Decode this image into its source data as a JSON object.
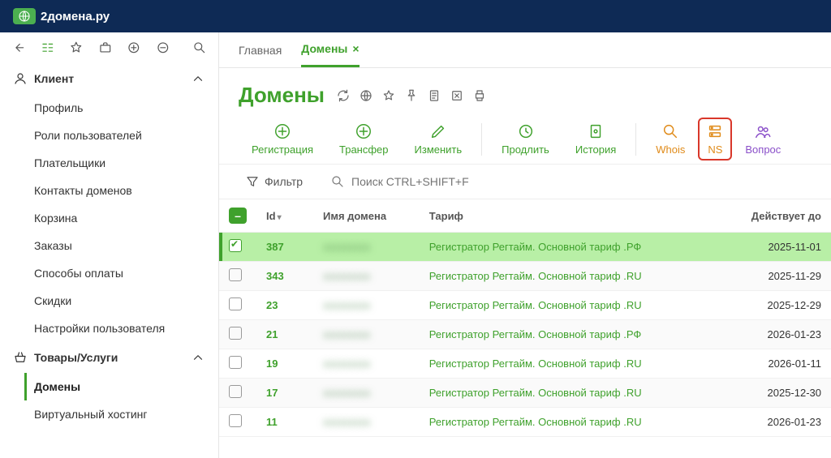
{
  "brand": "2домена.ру",
  "sidebar": {
    "section1": {
      "title": "Клиент",
      "items": [
        "Профиль",
        "Роли пользователей",
        "Плательщики",
        "Контакты доменов",
        "Корзина",
        "Заказы",
        "Способы оплаты",
        "Скидки",
        "Настройки пользователя"
      ]
    },
    "section2": {
      "title": "Товары/Услуги",
      "items": [
        "Домены",
        "Виртуальный хостинг"
      ],
      "active_index": 0
    }
  },
  "tabs": [
    {
      "label": "Главная",
      "closable": false,
      "active": false
    },
    {
      "label": "Домены",
      "closable": true,
      "active": true
    }
  ],
  "page_title": "Домены",
  "actions": [
    {
      "key": "register",
      "label": "Регистрация",
      "style": "green",
      "icon": "plus-circle"
    },
    {
      "key": "transfer",
      "label": "Трансфер",
      "style": "green",
      "icon": "plus-circle"
    },
    {
      "key": "edit",
      "label": "Изменить",
      "style": "green",
      "icon": "pencil"
    },
    {
      "key": "prolong",
      "label": "Продлить",
      "style": "green",
      "icon": "history"
    },
    {
      "key": "history",
      "label": "История",
      "style": "green",
      "icon": "doc"
    },
    {
      "key": "whois",
      "label": "Whois",
      "style": "orange",
      "icon": "magnifier"
    },
    {
      "key": "ns",
      "label": "NS",
      "style": "orange",
      "icon": "server",
      "highlight": true
    },
    {
      "key": "question",
      "label": "Вопрос",
      "style": "purple",
      "icon": "users"
    }
  ],
  "filter_label": "Фильтр",
  "search_placeholder": "Поиск CTRL+SHIFT+F",
  "columns": {
    "id": "Id",
    "name": "Имя домена",
    "tariff": "Тариф",
    "until": "Действует до"
  },
  "rows": [
    {
      "selected": true,
      "id": "387",
      "name": "—",
      "tariff": "Регистратор Регтайм. Основной тариф .РФ",
      "until": "2025-11-01"
    },
    {
      "selected": false,
      "id": "343",
      "name": "—",
      "tariff": "Регистратор Регтайм. Основной тариф .RU",
      "until": "2025-11-29"
    },
    {
      "selected": false,
      "id": "23",
      "name": "—",
      "tariff": "Регистратор Регтайм. Основной тариф .RU",
      "until": "2025-12-29"
    },
    {
      "selected": false,
      "id": "21",
      "name": "—",
      "tariff": "Регистратор Регтайм. Основной тариф .РФ",
      "until": "2026-01-23"
    },
    {
      "selected": false,
      "id": "19",
      "name": "—",
      "tariff": "Регистратор Регтайм. Основной тариф .RU",
      "until": "2026-01-11"
    },
    {
      "selected": false,
      "id": "17",
      "name": "—",
      "tariff": "Регистратор Регтайм. Основной тариф .RU",
      "until": "2025-12-30"
    },
    {
      "selected": false,
      "id": "11",
      "name": "—",
      "tariff": "Регистратор Регтайм. Основной тариф .RU",
      "until": "2026-01-23"
    }
  ]
}
